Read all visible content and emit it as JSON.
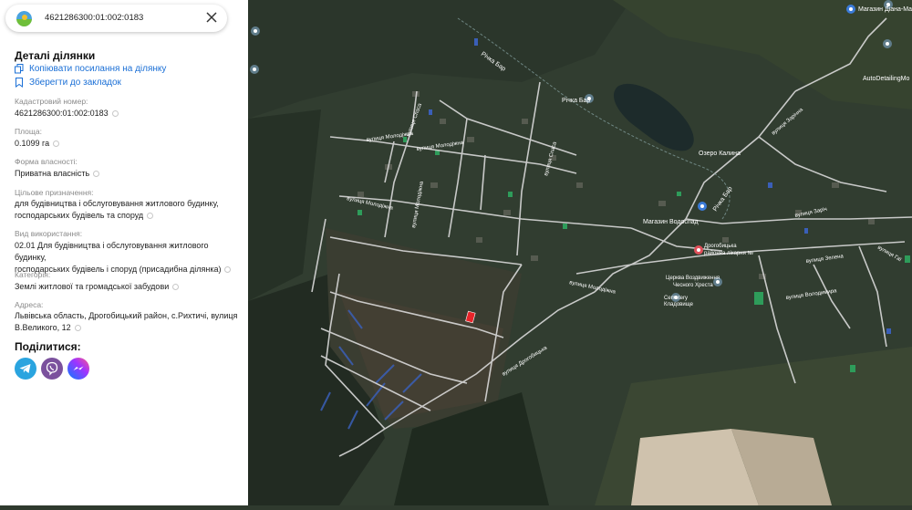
{
  "header": {
    "cadastral_number": "4621286300:01:002:0183",
    "close_icon": "close-icon",
    "logo_icon": "logo-icon"
  },
  "details": {
    "title": "Деталі ділянки",
    "copy_link_label": "Копіювати посилання на ділянку",
    "bookmark_label": "Зберегти до закладок",
    "fields": {
      "cadastral": {
        "label": "Кадастровий номер:",
        "value": "4621286300:01:002:0183"
      },
      "area": {
        "label": "Площа:",
        "value": "0.1099 га"
      },
      "ownership": {
        "label": "Форма власності:",
        "value": "Приватна власність"
      },
      "purpose": {
        "label": "Цільове призначення:",
        "line1": "для будівництва і обслуговування житлового будинку,",
        "line2": "господарських будівель та споруд"
      },
      "usage": {
        "label": "Вид використання:",
        "line1": "02.01 Для будівництва і обслуговування житлового будинку,",
        "line2": "господарських будівель і споруд (присадибна ділянка)"
      },
      "category": {
        "label": "Категорія:",
        "value": "Землі житлової та громадської забудови"
      },
      "address": {
        "label": "Адреса:",
        "line1": "Львівська область, Дрогобицький район, с.Рихтичі, вулиця",
        "line2": "В.Великого, 12"
      }
    }
  },
  "share": {
    "title": "Поділитися:",
    "telegram_icon": "telegram-icon",
    "viber_icon": "viber-icon",
    "messenger_icon": "messenger-icon"
  },
  "map": {
    "labels": {
      "river1": "Річка Бар",
      "river2": "Річка Бар",
      "river3": "Річка Бар",
      "lake": "Озеро Калина",
      "shop1": "Магазин Діана-Мар",
      "shop2": "Магазин Водоспад",
      "autodetail": "AutoDetailingMo",
      "hospital_line1": "Дрогобицька",
      "hospital_line2": "районна лікарня №",
      "church_line1": "Церква Воздвиження",
      "church_line2": "Чесного Хреста",
      "cemetery_line1": "Cemetery",
      "cemetery_line2": "Кладовище",
      "street_molodizhna": "вулиця Молодіжна",
      "street_molodizhna2": "вулиця Молодіжна",
      "street_molodizhna3": "вулиця Молодіжна",
      "street_molodizhna4": "вулиця Молодіжна",
      "street_spasa": "вулиця Спаса",
      "street_spasa2": "вулиця Спаса",
      "street_zarichna": "вулиця Зарічна",
      "street_zarichna2": "вулиця Заріч",
      "street_drohobytska": "вулиця Дрогобицька",
      "street_molodizhna5": "вулиця Молодіжна",
      "street_zelena": "вулиця Зелена",
      "street_volodymyra": "вулиця Володимира",
      "street_gai": "вулиця Гаї"
    },
    "colors": {
      "plot": "#e8242a",
      "roads": "#d9d9d9",
      "fields_blue": "#3a5fb8"
    }
  }
}
